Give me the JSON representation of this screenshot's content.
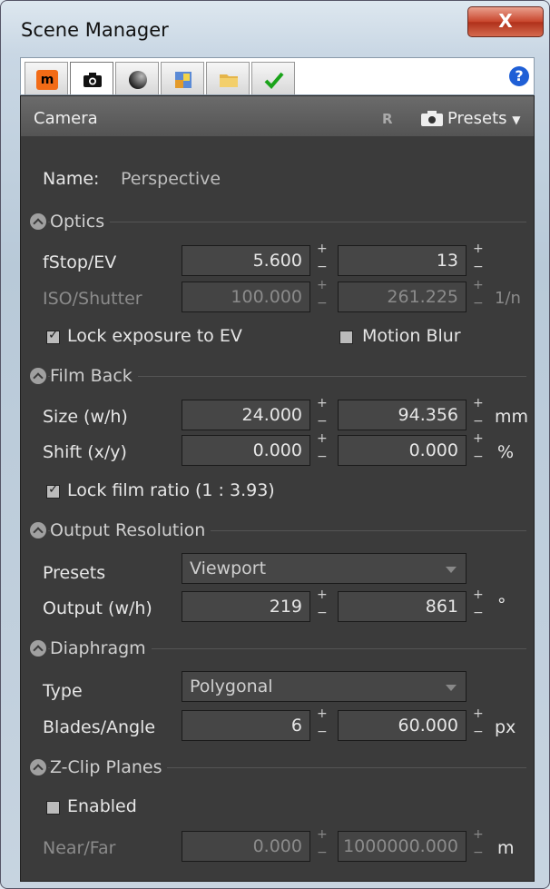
{
  "window": {
    "title": "Scene Manager",
    "close_glyph": "X"
  },
  "tabs": [
    {
      "icon": "material-icon"
    },
    {
      "icon": "camera-icon"
    },
    {
      "icon": "environment-sphere-icon"
    },
    {
      "icon": "image-icon"
    },
    {
      "icon": "folder-icon"
    },
    {
      "icon": "checkmark-icon"
    }
  ],
  "help_glyph": "?",
  "panel": {
    "title": "Camera",
    "reset_label": "R",
    "presets_label": "Presets"
  },
  "name": {
    "label": "Name:",
    "value": "Perspective"
  },
  "optics": {
    "title": "Optics",
    "fstop": {
      "label": "fStop/EV",
      "v1": "5.600",
      "v2": "13"
    },
    "iso": {
      "label": "ISO/Shutter",
      "v1": "100.000",
      "v2": "261.225",
      "unit": "1/n"
    },
    "lock_exposure": {
      "label": "Lock exposure to EV",
      "checked": true
    },
    "motion_blur": {
      "label": "Motion Blur",
      "checked": false
    }
  },
  "film_back": {
    "title": "Film Back",
    "size": {
      "label": "Size (w/h)",
      "v1": "24.000",
      "v2": "94.356",
      "unit": "mm"
    },
    "shift": {
      "label": "Shift (x/y)",
      "v1": "0.000",
      "v2": "0.000",
      "unit": "%"
    },
    "lock_ratio": {
      "label": "Lock film ratio (1 : 3.93)",
      "checked": true
    }
  },
  "output": {
    "title": "Output Resolution",
    "presets": {
      "label": "Presets",
      "value": "Viewport"
    },
    "size": {
      "label": "Output (w/h)",
      "v1": "219",
      "v2": "861",
      "unit": "°"
    }
  },
  "diaphragm": {
    "title": "Diaphragm",
    "type": {
      "label": "Type",
      "value": "Polygonal"
    },
    "blades": {
      "label": "Blades/Angle",
      "v1": "6",
      "v2": "60.000",
      "unit": "px"
    }
  },
  "zclip": {
    "title": "Z-Clip Planes",
    "enabled": {
      "label": "Enabled",
      "checked": false
    },
    "nearfar": {
      "label": "Near/Far",
      "v1": "0.000",
      "v2": "1000000.000",
      "unit": "m"
    }
  },
  "spinner": {
    "plus": "+",
    "minus": "−"
  }
}
